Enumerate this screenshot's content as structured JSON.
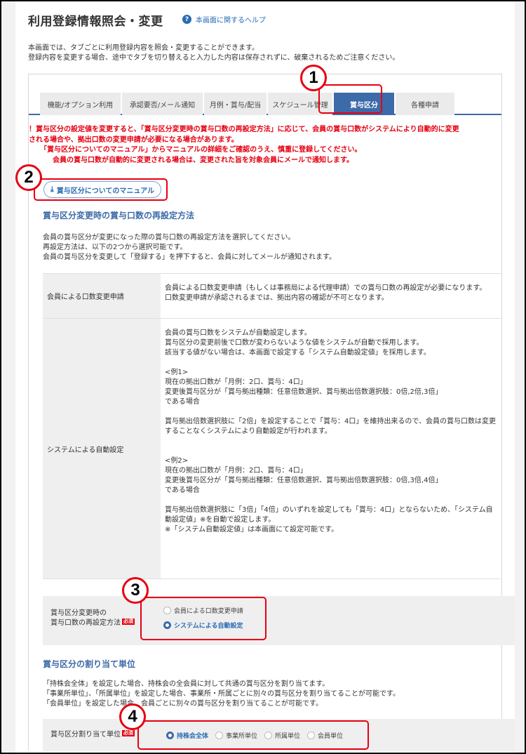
{
  "page": {
    "title": "利用登録情報照会・変更",
    "help_link": "本画面に関するヘルプ",
    "intro": [
      "本画面では、タブごとに利用登録内容を照会・変更することができます。",
      "登録内容を変更する場合、途中でタブを切り替えると入力した内容は保存されずに、破棄されるためご注意ください。"
    ]
  },
  "tabs": [
    {
      "label": "機能/オプション利用"
    },
    {
      "label": "承認要否/メール通知"
    },
    {
      "label": "月例・賞与/配当"
    },
    {
      "label": "スケジュール管理"
    },
    {
      "label": "賞与区分"
    },
    {
      "label": "各種申請"
    }
  ],
  "warnings": [
    "！賞与区分の設定値を変更すると、「賞与区分変更時の賞与口数の再設定方法」に応じて、会員の賞与口数がシステムにより自動的に変更",
    "される場合や、拠出口数の変更申請が必要になる場合があります。",
    "「賞与区分についてのマニュアル」からマニュアルの詳細をご確認のうえ、慎重に登録してください。",
    "会員の賞与口数が自動的に変更される場合は、変更された旨を対象会員にメールで通知します。"
  ],
  "manual_button": "賞与区分についてのマニュアル",
  "section1": {
    "heading": "賞与区分変更時の賞与口数の再設定方法",
    "desc": [
      "会員の賞与区分が変更になった際の賞与口数の再設定方法を選択してください。",
      "再設定方法は、以下の2つから選択可能です。",
      "会員の賞与区分を変更して「登録する」を押下すると、会員に対してメールが通知されます。"
    ],
    "table": [
      {
        "header": "会員による口数変更申請",
        "lines": [
          "会員による口数変更申請（もしくは事務局による代理申請）での賞与口数の再設定が必要になります。",
          "口数変更申請が承認されるまでは、拠出内容の確認が不可となります。"
        ]
      },
      {
        "header": "システムによる自動設定",
        "lines": [
          "会員の賞与口数をシステムが自動設定します。",
          "賞与区分の変更前後で口数が変わらないような値をシステムが自動で採用します。",
          "該当する値がない場合は、本画面で設定する「システム自動設定値」を採用します。",
          "",
          "<例1>",
          "現在の拠出口数が「月例：2口、賞与：4口」",
          "変更後賞与区分が「賞与拠出種類：任意倍数選択、賞与拠出倍数選択肢：0倍,2倍,3倍」",
          "である場合",
          "",
          "賞与拠出倍数選択肢に「2倍」を設定することで「賞与：4口」を維持出来るので、会員の賞与口数は変更",
          "することなくシステムにより自動設定が行われます。",
          "",
          "",
          "<例2>",
          "現在の拠出口数が「月例：2口、賞与：4口」",
          "変更後賞与区分が「賞与拠出種類：任意倍数選択、賞与拠出倍数選択肢：0倍,3倍,4倍」",
          "である場合",
          "",
          "賞与拠出倍数選択肢に「3倍」「4倍」のいずれを設定しても「賞与：4口」とならないため、「システム自",
          "動設定値」※を自動で設定します。",
          "※「システム自動設定値」は本画面にて設定可能です。"
        ]
      }
    ],
    "form_label_1": "賞与区分変更時の",
    "form_label_2": "賞与口数の再設定方法",
    "required": "必須",
    "options": [
      "会員による口数変更申請",
      "システムによる自動設定"
    ],
    "selected": "システムによる自動設定"
  },
  "section2": {
    "heading": "賞与区分の割り当て単位",
    "desc": [
      "「持株会全体」を設定した場合、持株会の全会員に対して共通の賞与区分を割り当てます。",
      "「事業所単位」、「所属単位」を設定した場合、事業所・所属ごとに別々の賞与区分を割り当てることが可能です。",
      "「会員単位」を設定した場合、会員ごとに別々の賞与区分を割り当てることが可能です。"
    ],
    "form_label": "賞与区分割り当て単位",
    "required": "必須",
    "options": [
      "持株会全体",
      "事業所単位",
      "所属単位",
      "会員単位"
    ],
    "selected": "持株会全体"
  },
  "callouts": [
    "1",
    "2",
    "3",
    "4"
  ],
  "colors": {
    "accent": "#3d6aa8",
    "warning": "#e60012",
    "callout": "#e60012"
  }
}
